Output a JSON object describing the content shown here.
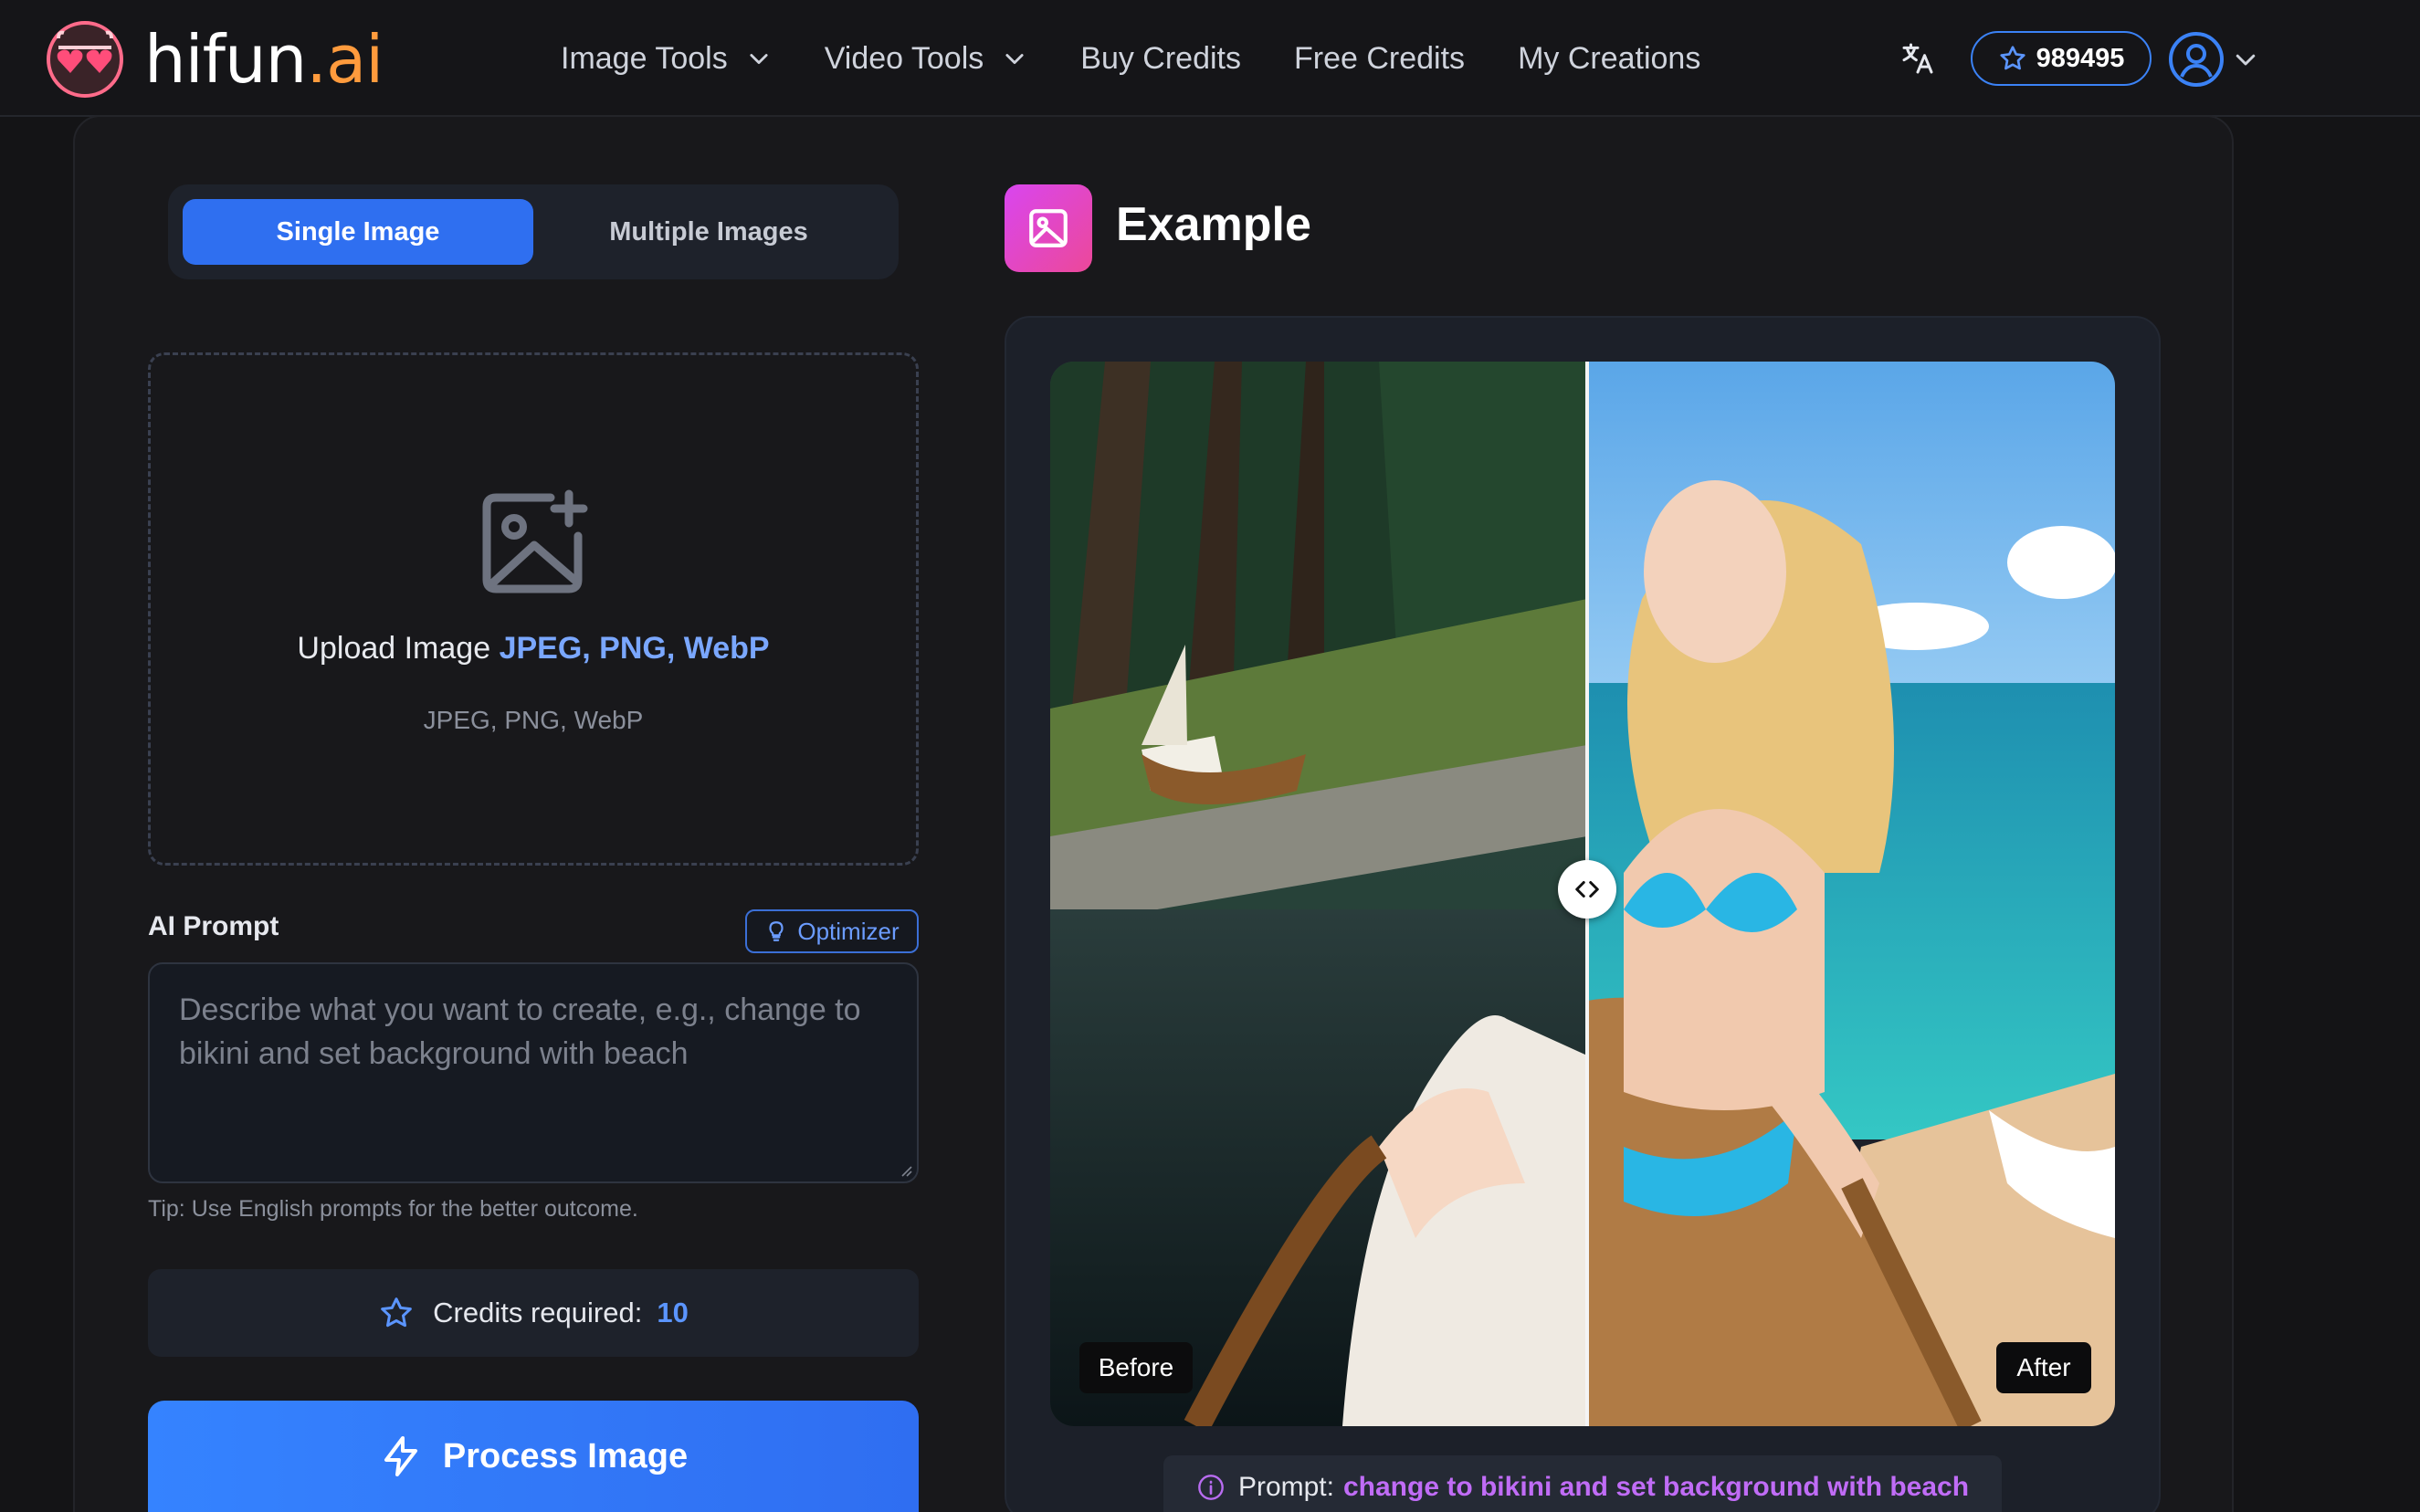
{
  "brand": {
    "name": "hifun",
    "suffix": ".ai"
  },
  "nav": {
    "items": [
      {
        "label": "Image Tools",
        "has_dropdown": true
      },
      {
        "label": "Video Tools",
        "has_dropdown": true
      },
      {
        "label": "Buy Credits",
        "has_dropdown": false
      },
      {
        "label": "Free Credits",
        "has_dropdown": false
      },
      {
        "label": "My Creations",
        "has_dropdown": false
      }
    ],
    "credits_balance": "989495",
    "icons": [
      "translate-icon",
      "star-icon",
      "user-avatar-icon",
      "chevron-down-icon"
    ]
  },
  "left": {
    "tabs": [
      {
        "label": "Single Image",
        "active": true
      },
      {
        "label": "Multiple Images",
        "active": false
      }
    ],
    "upload": {
      "title": "Upload Image",
      "formats": "JPEG, PNG, WebP",
      "subtitle": "JPEG, PNG, WebP"
    },
    "prompt": {
      "label": "AI Prompt",
      "optimizer_label": "Optimizer",
      "placeholder": "Describe what you want to create, e.g., change to bikini and set background with beach",
      "tip": "Tip: Use English prompts for the better outcome."
    },
    "credits_required": {
      "label": "Credits required:",
      "value": "10"
    },
    "process_button": "Process Image"
  },
  "right": {
    "title": "Example",
    "before_label": "Before",
    "after_label": "After",
    "prompt_label": "Prompt:",
    "prompt_value": "change to bikini and set background with beach"
  },
  "colors": {
    "accent": "#2f6ff0",
    "brand_orange": "#ff9b3d",
    "prompt_purple": "#c06cf6",
    "background": "#141416"
  }
}
